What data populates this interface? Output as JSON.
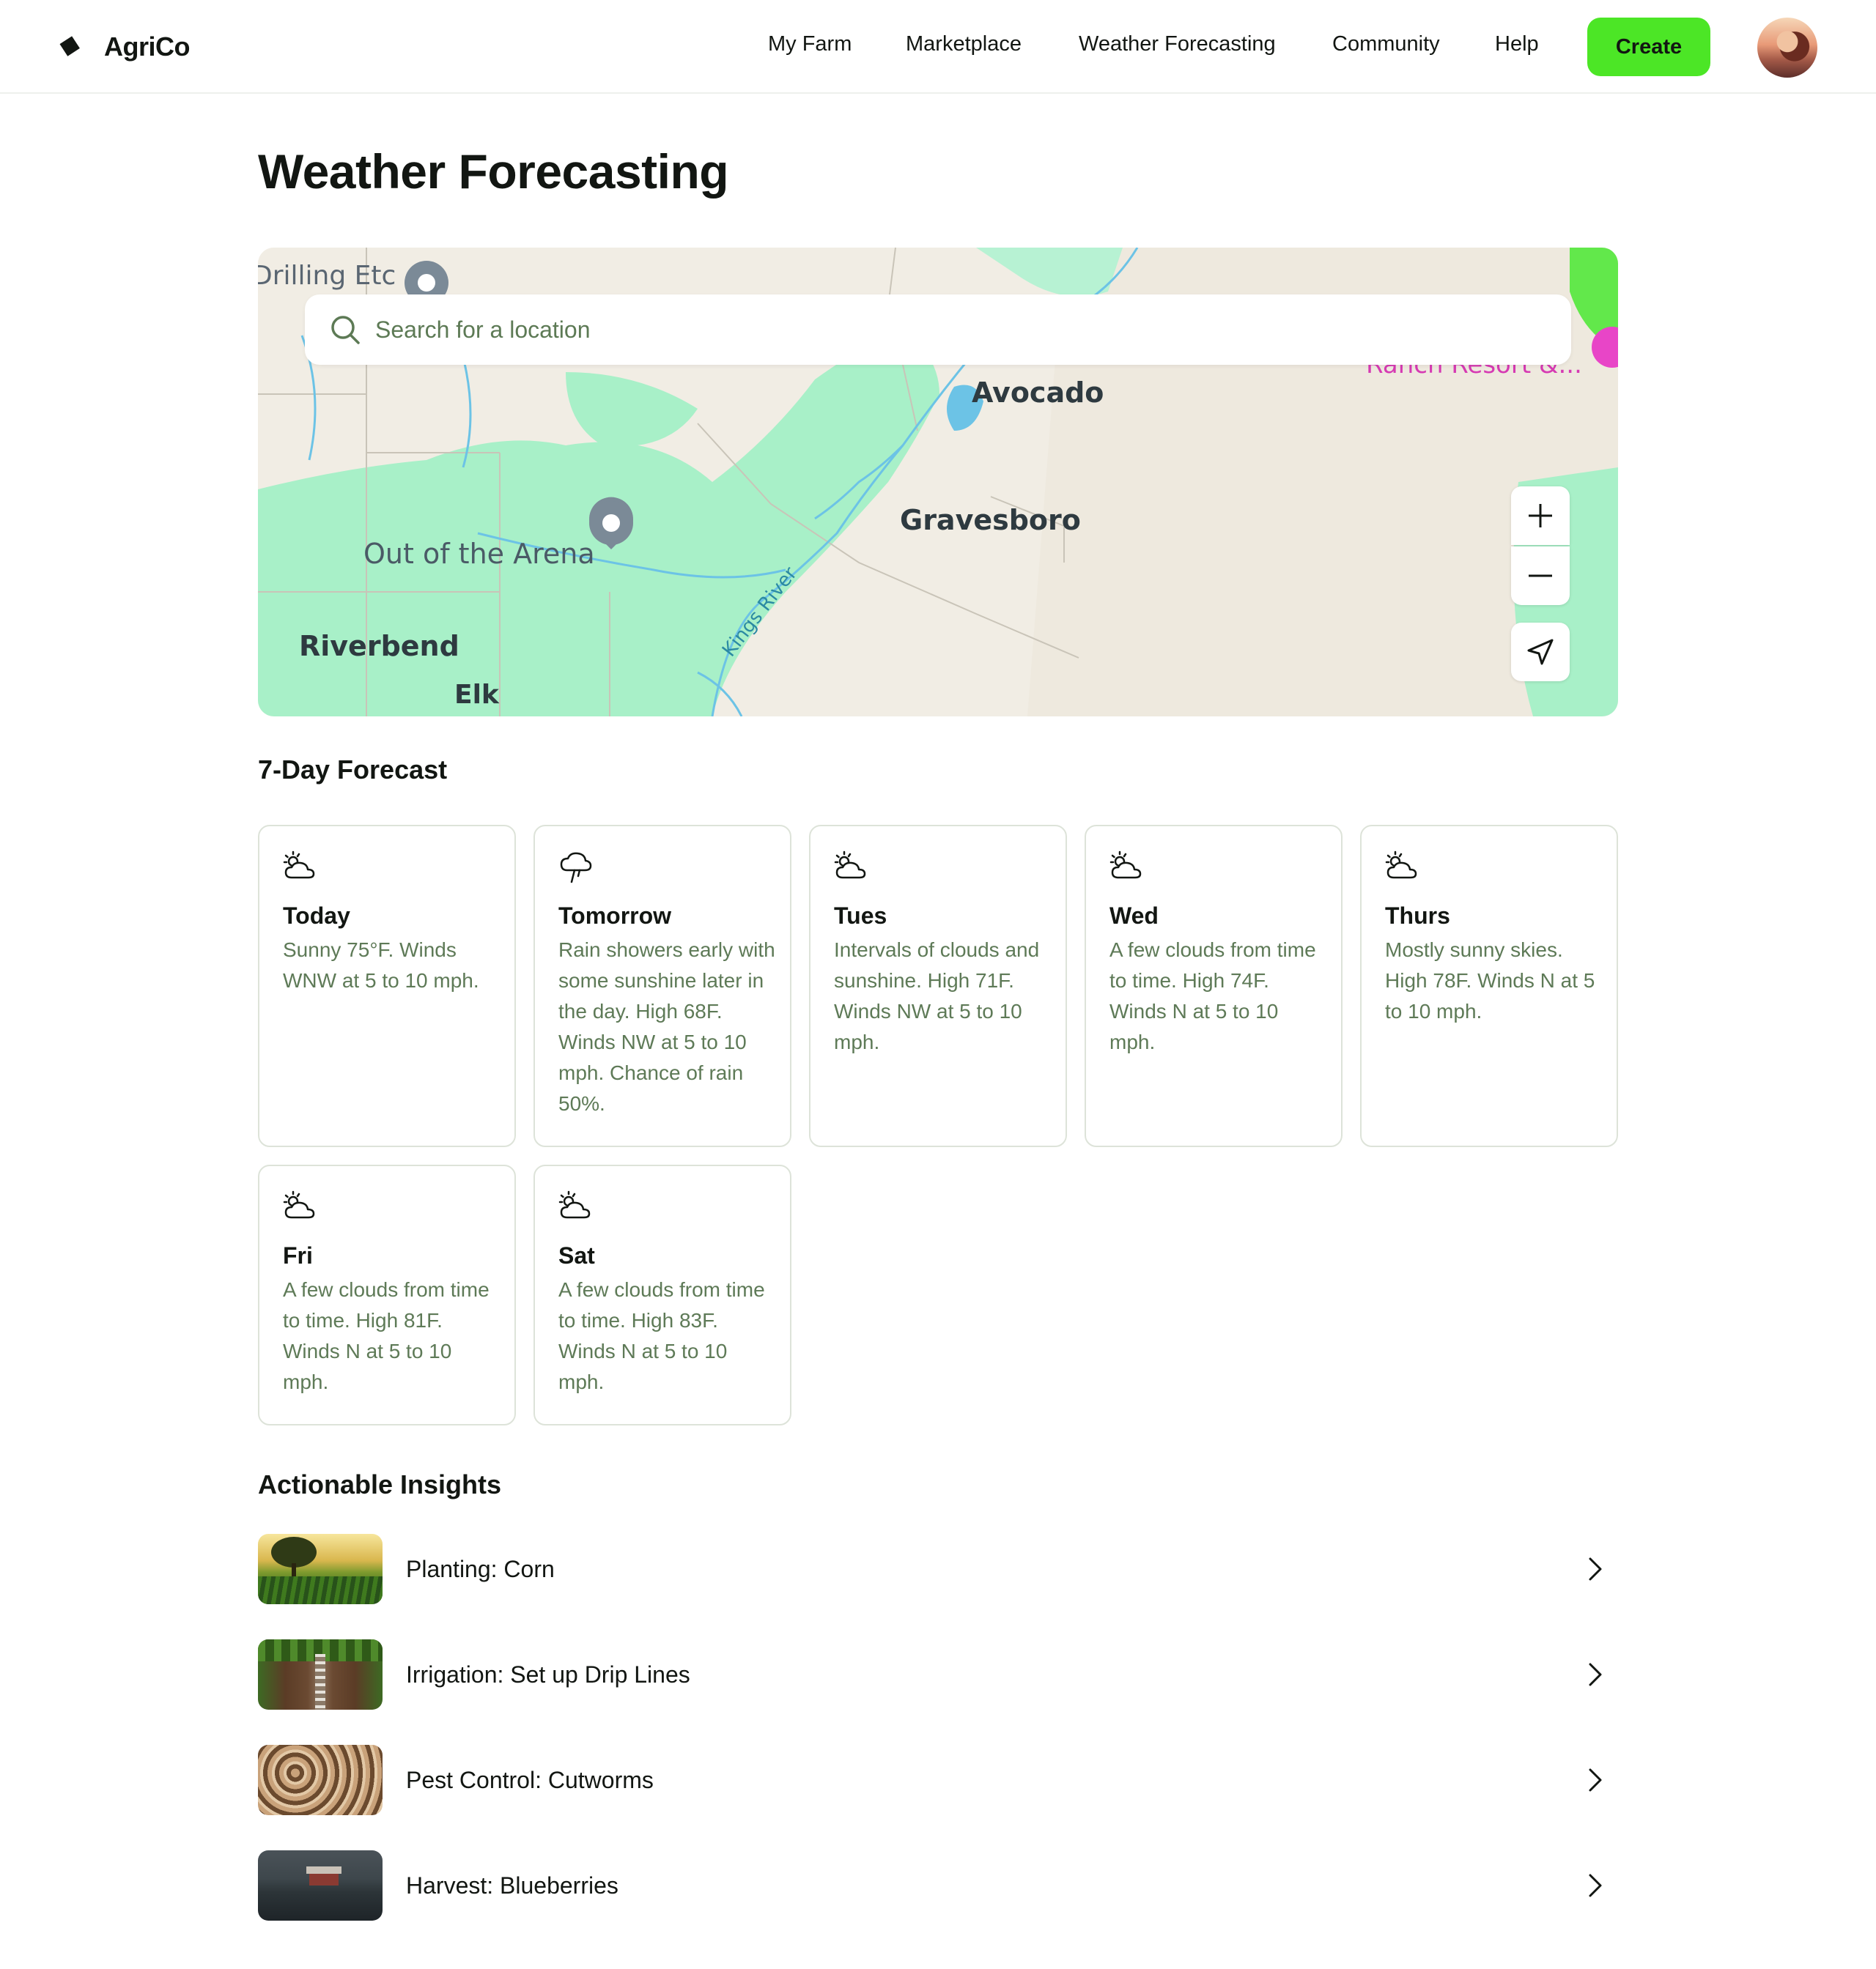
{
  "header": {
    "brand": "AgriCo",
    "nav": [
      "My Farm",
      "Marketplace",
      "Weather Forecasting",
      "Community",
      "Help"
    ],
    "create_label": "Create"
  },
  "page": {
    "title": "Weather Forecasting"
  },
  "map": {
    "search_placeholder": "Search for a location",
    "labels": {
      "drilling": "Drilling Etc",
      "ranch": "Ranch Resort &...",
      "avocado": "Avocado",
      "gravesboro": "Gravesboro",
      "arena": "Out of the Arena",
      "riverbend": "Riverbend",
      "elk": "Elk",
      "kings_river": "Kings River"
    },
    "controls": {
      "zoom_in_icon": "plus-icon",
      "zoom_out_icon": "minus-icon",
      "locate_icon": "navigation-arrow-icon"
    }
  },
  "forecast": {
    "title": "7-Day Forecast",
    "days": [
      {
        "day": "Today",
        "icon": "sun-cloud-icon",
        "desc": "Sunny 75°F. Winds WNW at 5 to 10 mph."
      },
      {
        "day": "Tomorrow",
        "icon": "cloud-rain-icon",
        "desc": "Rain showers early with some sunshine later in the day. High 68F. Winds NW at 5 to 10 mph. Chance of rain 50%."
      },
      {
        "day": "Tues",
        "icon": "sun-cloud-icon",
        "desc": "Intervals of clouds and sunshine. High 71F. Winds NW at 5 to 10 mph."
      },
      {
        "day": "Wed",
        "icon": "sun-cloud-icon",
        "desc": "A few clouds from time to time. High 74F. Winds N at 5 to 10 mph."
      },
      {
        "day": "Thurs",
        "icon": "sun-cloud-icon",
        "desc": "Mostly sunny skies. High 78F. Winds N at 5 to 10 mph."
      },
      {
        "day": "Fri",
        "icon": "sun-cloud-icon",
        "desc": "A few clouds from time to time. High 81F. Winds N at 5 to 10 mph."
      },
      {
        "day": "Sat",
        "icon": "sun-cloud-icon",
        "desc": "A few clouds from time to time. High 83F. Winds N at 5 to 10 mph."
      }
    ]
  },
  "insights": {
    "title": "Actionable Insights",
    "items": [
      {
        "label": "Planting: Corn"
      },
      {
        "label": "Irrigation: Set up Drip Lines"
      },
      {
        "label": "Pest Control: Cutworms"
      },
      {
        "label": "Harvest: Blueberries"
      }
    ]
  },
  "colors": {
    "accent": "#4ce626",
    "muted_text": "#5e7a57",
    "card_border": "#dde3d9",
    "map_green": "#a8f0c8"
  }
}
